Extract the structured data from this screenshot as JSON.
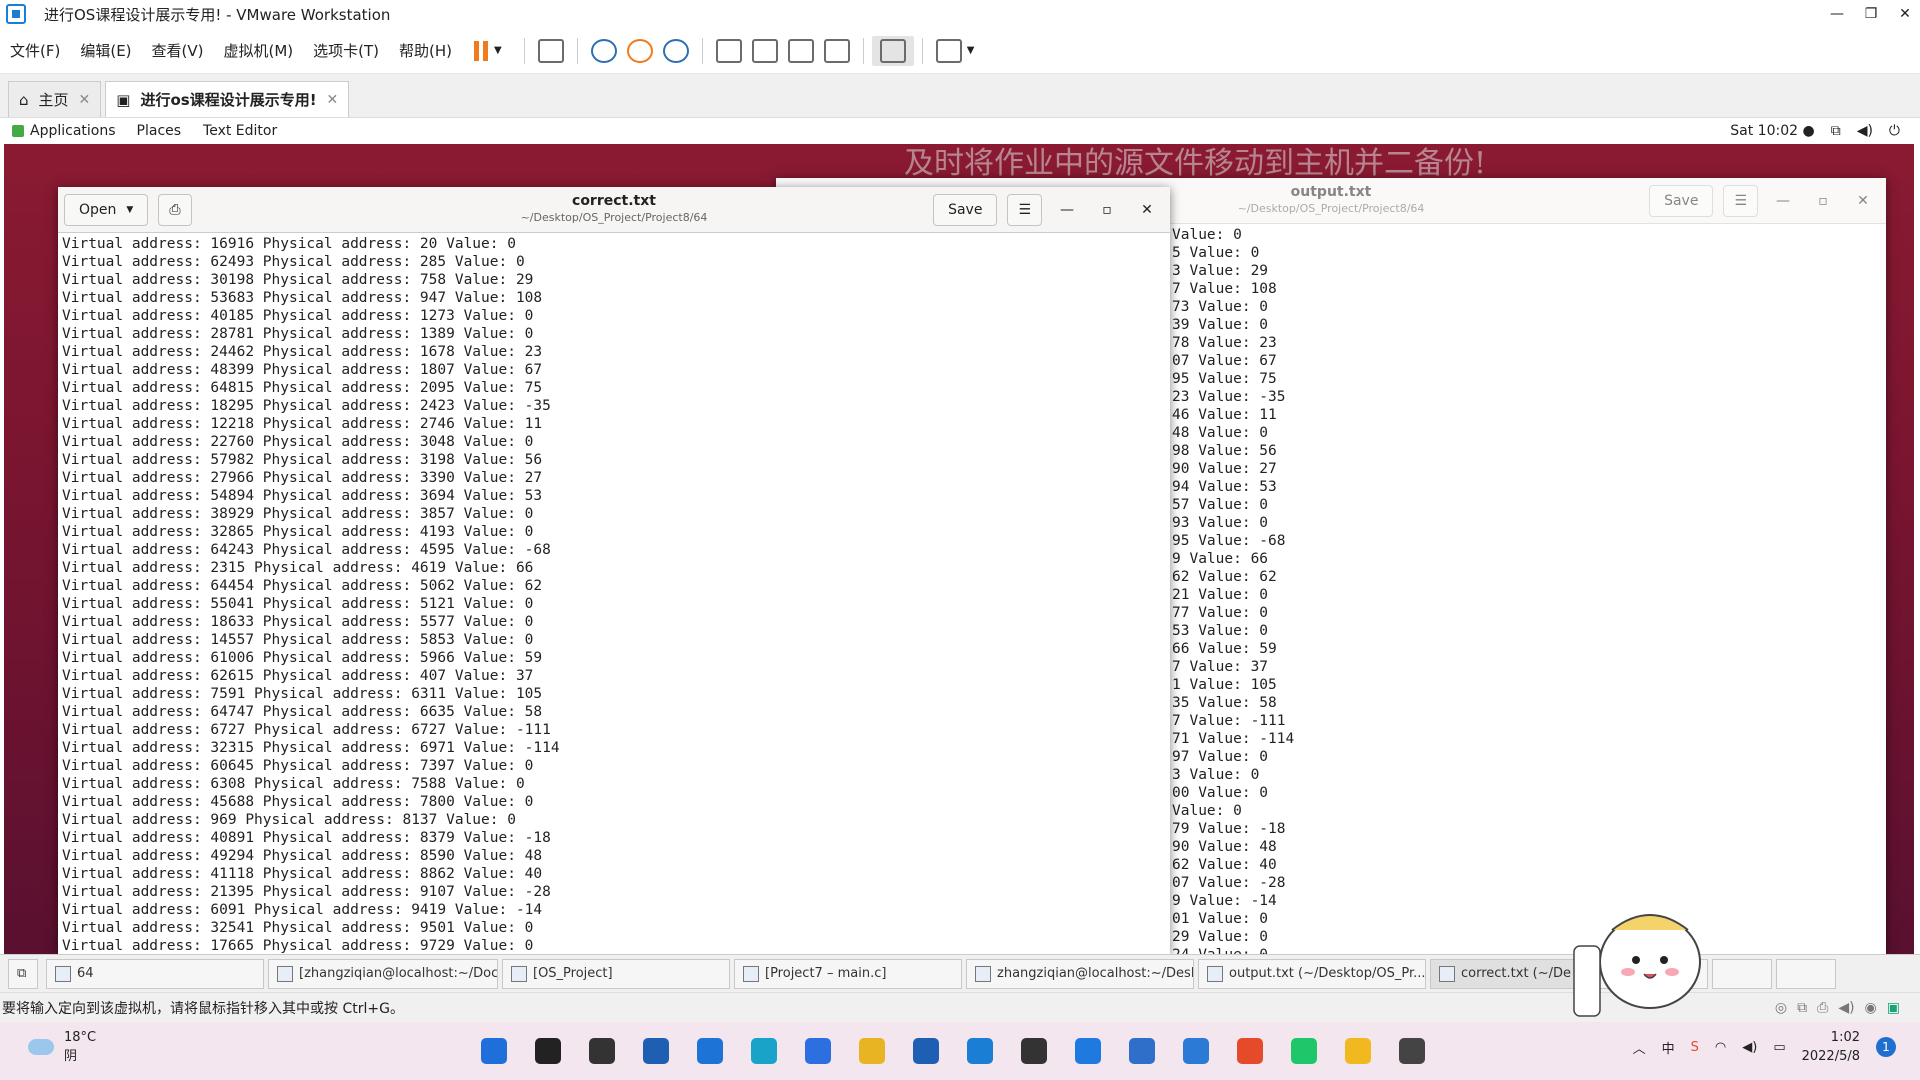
{
  "vmware": {
    "title": "进行OS课程设计展示专用! - VMware Workstation",
    "menu": [
      "文件(F)",
      "编辑(E)",
      "查看(V)",
      "虚拟机(M)",
      "选项卡(T)",
      "帮助(H)"
    ],
    "tabs": [
      {
        "label": "主页",
        "selected": false
      },
      {
        "label": "进行os课程设计展示专用!",
        "selected": true
      }
    ]
  },
  "gnome_bar": {
    "applications": "Applications",
    "places": "Places",
    "text_editor": "Text Editor",
    "clock": "Sat 10:02 ●"
  },
  "desktop_text": "及时将作业中的源文件移动到主机并二备份!",
  "correct_window": {
    "open_label": "Open",
    "title": "correct.txt",
    "path": "~/Desktop/OS_Project/Project8/64",
    "save_label": "Save",
    "lines": [
      "Virtual address: 16916 Physical address: 20 Value: 0",
      "Virtual address: 62493 Physical address: 285 Value: 0",
      "Virtual address: 30198 Physical address: 758 Value: 29",
      "Virtual address: 53683 Physical address: 947 Value: 108",
      "Virtual address: 40185 Physical address: 1273 Value: 0",
      "Virtual address: 28781 Physical address: 1389 Value: 0",
      "Virtual address: 24462 Physical address: 1678 Value: 23",
      "Virtual address: 48399 Physical address: 1807 Value: 67",
      "Virtual address: 64815 Physical address: 2095 Value: 75",
      "Virtual address: 18295 Physical address: 2423 Value: -35",
      "Virtual address: 12218 Physical address: 2746 Value: 11",
      "Virtual address: 22760 Physical address: 3048 Value: 0",
      "Virtual address: 57982 Physical address: 3198 Value: 56",
      "Virtual address: 27966 Physical address: 3390 Value: 27",
      "Virtual address: 54894 Physical address: 3694 Value: 53",
      "Virtual address: 38929 Physical address: 3857 Value: 0",
      "Virtual address: 32865 Physical address: 4193 Value: 0",
      "Virtual address: 64243 Physical address: 4595 Value: -68",
      "Virtual address: 2315 Physical address: 4619 Value: 66",
      "Virtual address: 64454 Physical address: 5062 Value: 62",
      "Virtual address: 55041 Physical address: 5121 Value: 0",
      "Virtual address: 18633 Physical address: 5577 Value: 0",
      "Virtual address: 14557 Physical address: 5853 Value: 0",
      "Virtual address: 61006 Physical address: 5966 Value: 59",
      "Virtual address: 62615 Physical address: 407 Value: 37",
      "Virtual address: 7591 Physical address: 6311 Value: 105",
      "Virtual address: 64747 Physical address: 6635 Value: 58",
      "Virtual address: 6727 Physical address: 6727 Value: -111",
      "Virtual address: 32315 Physical address: 6971 Value: -114",
      "Virtual address: 60645 Physical address: 7397 Value: 0",
      "Virtual address: 6308 Physical address: 7588 Value: 0",
      "Virtual address: 45688 Physical address: 7800 Value: 0",
      "Virtual address: 969 Physical address: 8137 Value: 0",
      "Virtual address: 40891 Physical address: 8379 Value: -18",
      "Virtual address: 49294 Physical address: 8590 Value: 48",
      "Virtual address: 41118 Physical address: 8862 Value: 40",
      "Virtual address: 21395 Physical address: 9107 Value: -28",
      "Virtual address: 6091 Physical address: 9419 Value: -14",
      "Virtual address: 32541 Physical address: 9501 Value: 0",
      "Virtual address: 17665 Physical address: 9729 Value: 0"
    ]
  },
  "output_window": {
    "title": "output.txt",
    "path": "~/Desktop/OS_Project/Project8/64",
    "save_label": "Save",
    "lines": [
      "Value: 0",
      "5 Value: 0",
      "3 Value: 29",
      "7 Value: 108",
      "73 Value: 0",
      "39 Value: 0",
      "78 Value: 23",
      "07 Value: 67",
      "95 Value: 75",
      "23 Value: -35",
      "46 Value: 11",
      "48 Value: 0",
      "98 Value: 56",
      "90 Value: 27",
      "94 Value: 53",
      "57 Value: 0",
      "93 Value: 0",
      "95 Value: -68",
      "9 Value: 66",
      "62 Value: 62",
      "21 Value: 0",
      "77 Value: 0",
      "53 Value: 0",
      "66 Value: 59",
      "7 Value: 37",
      "1 Value: 105",
      "35 Value: 58",
      "7 Value: -111",
      "71 Value: -114",
      "97 Value: 0",
      "3 Value: 0",
      "00 Value: 0",
      "Value: 0",
      "79 Value: -18",
      "90 Value: 48",
      "62 Value: 40",
      "07 Value: -28",
      "9 Value: -14",
      "01 Value: 0",
      "29 Value: 0",
      "24 Value: 0"
    ]
  },
  "vm_taskbar": [
    "64",
    "[zhangziqian@localhost:~/Doc...",
    "[OS_Project]",
    "[Project7 – main.c]",
    "zhangziqian@localhost:~/Desk...",
    "output.txt (~/Desktop/OS_Pr...",
    "correct.txt (~/De"
  ],
  "vm_status": "要将输入定向到该虚拟机，请将鼠标指针移入其中或按 Ctrl+G。",
  "windows_taskbar": {
    "temperature": "18°C",
    "weather": "阴",
    "time": "1:02",
    "date": "2022/5/8",
    "notifications": "1",
    "ime": "中",
    "pinned_icons": [
      "start-icon",
      "search-icon",
      "task-view-icon",
      "store-icon",
      "mail-icon",
      "edge-icon",
      "todo-icon",
      "explorer-icon",
      "outlook-icon",
      "vmware-icon",
      "terminal-icon",
      "whiteboard-icon",
      "notepad-icon",
      "vscode-icon",
      "wps-icon",
      "media-icon",
      "browser-icon",
      "typora-icon"
    ],
    "pinned_colors": [
      "#1e6fd9",
      "#222222",
      "#333333",
      "#1f5fb3",
      "#1e73d6",
      "#1aa3c9",
      "#2b6fe0",
      "#e8b423",
      "#1e5fb3",
      "#1a7fd4",
      "#333333",
      "#1f7ae0",
      "#2f6fc9",
      "#2a7ad6",
      "#e54b2a",
      "#1ec86a",
      "#f2b81f",
      "#444444"
    ]
  }
}
